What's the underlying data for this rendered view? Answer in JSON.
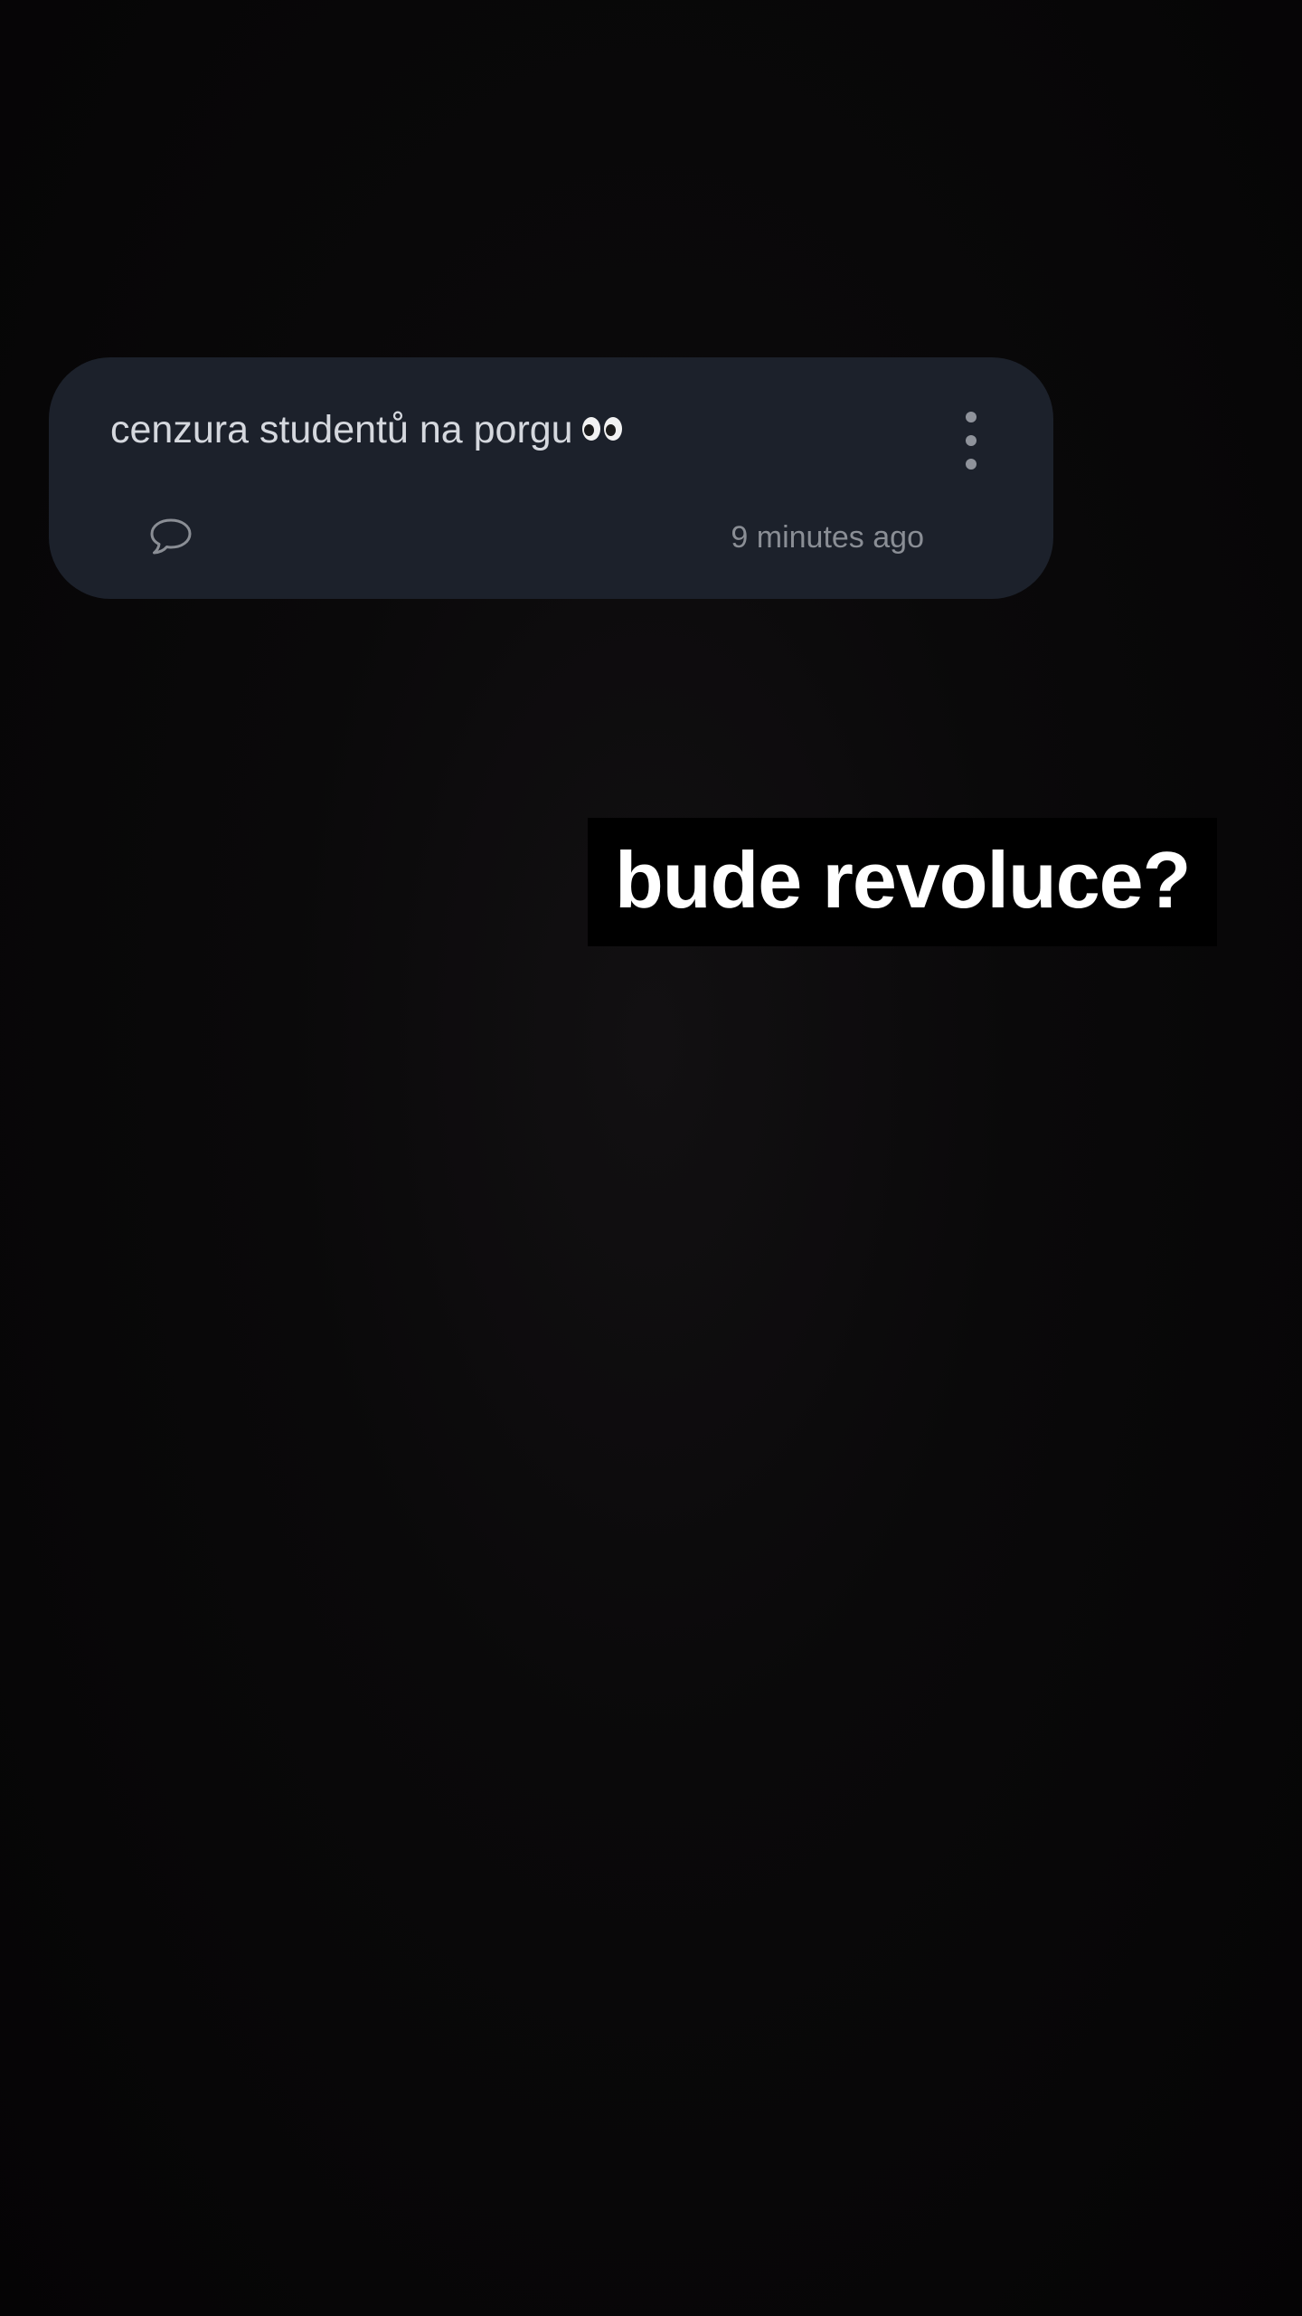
{
  "post": {
    "text": "cenzura studentů na porgu",
    "emoji_icon": "eyes-emoji",
    "comment_icon": "speech-bubble-icon",
    "menu_icon": "more-vertical-icon",
    "timestamp": "9 minutes ago"
  },
  "overlay": {
    "text": "bude revoluce?"
  },
  "colors": {
    "background": "#060506",
    "card": "#1c212b",
    "card_text": "#d5d8de",
    "muted": "#8a8e95",
    "overlay_bg": "#000000",
    "overlay_text": "#ffffff"
  }
}
